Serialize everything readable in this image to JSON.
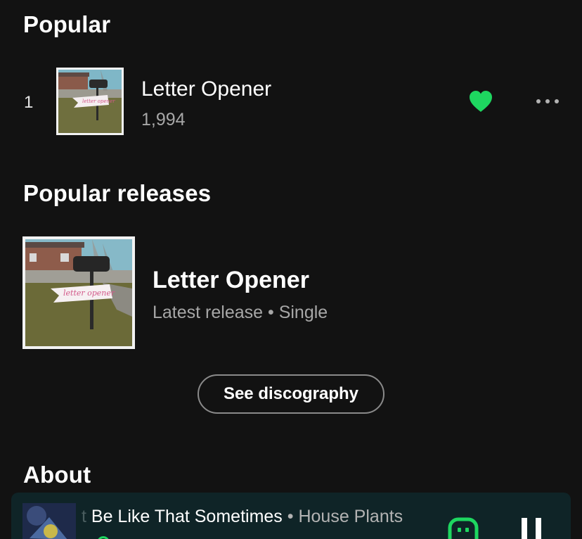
{
  "popular": {
    "heading": "Popular",
    "tracks": [
      {
        "rank": "1",
        "title": "Letter Opener",
        "plays": "1,994",
        "liked": true
      }
    ]
  },
  "releases": {
    "heading": "Popular releases",
    "items": [
      {
        "title": "Letter Opener",
        "meta": "Latest release • Single"
      }
    ],
    "see_discography_label": "See discography"
  },
  "about": {
    "heading": "About"
  },
  "player": {
    "song": "Be Like That Sometimes",
    "separator": "•",
    "artist": "House Plants",
    "ghost_prefix": "t"
  },
  "colors": {
    "background": "#121212",
    "accent": "#1ed760",
    "player_bg": "#0f2427",
    "muted_text": "#a7a7a7"
  },
  "icons": {
    "like": "heart-icon",
    "more": "more-options-icon",
    "devices": "connect-device-icon",
    "pause": "pause-icon"
  }
}
